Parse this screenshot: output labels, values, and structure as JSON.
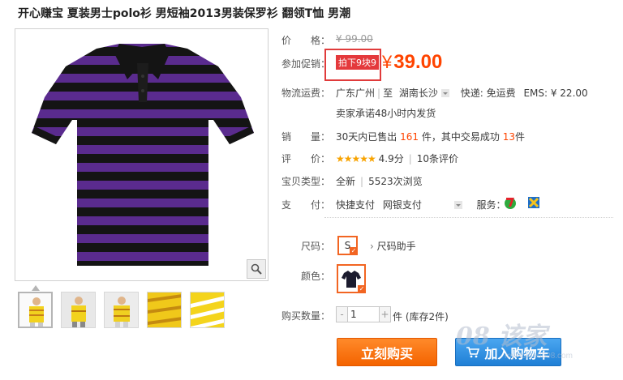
{
  "product": {
    "title": "开心赚宝 夏装男士polo衫 男短袖2013男装保罗衫 翻领T恤 男潮"
  },
  "pricing": {
    "price_label": "价　　格：",
    "original_price": "¥ 99.00",
    "promo_label": "参加促销：",
    "promo_tag": "拍下9块9",
    "currency_symbol": "¥",
    "promo_price": "39.00"
  },
  "shipping": {
    "label": "物流运费：",
    "from": "广东广州",
    "to_prefix": "至",
    "to": "湖南长沙",
    "express": "快递: 免运费",
    "ems": "EMS: ¥ 22.00",
    "promise": "卖家承诺48小时内发货"
  },
  "sales": {
    "label": "销　　量：",
    "prefix": "30天内已售出",
    "sold": "161",
    "mid": "件，其中交易成功",
    "success": "13",
    "suffix": "件"
  },
  "rating": {
    "label": "评　　价：",
    "stars": "★★★★★",
    "score": "4.9分",
    "reviews": "10条评价"
  },
  "item_type": {
    "label": "宝贝类型：",
    "condition": "全新",
    "views": "5523次浏览"
  },
  "payment": {
    "label": "支　　付：",
    "method1": "快捷支付",
    "method2": "网银支付",
    "service_label": "服务："
  },
  "options": {
    "size_label": "尺码：",
    "size_value": "S",
    "size_helper": "尺码助手",
    "color_label": "颜色：",
    "qty_label": "购买数量：",
    "qty_value": "1",
    "stock": "件 (库存2件)"
  },
  "actions": {
    "buy_now": "立刻购买",
    "add_cart": "加入购物车"
  },
  "watermark": {
    "main": "08 该家",
    "sub": "myHome0008.com"
  },
  "colors": {
    "accent": "#ff4400",
    "buy": "#f46300",
    "cart": "#1f7fd5",
    "stripe": "#5b2a8c"
  }
}
